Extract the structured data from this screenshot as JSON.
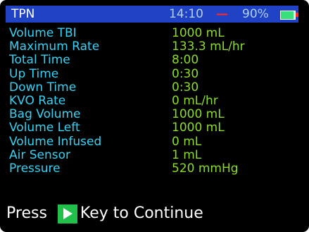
{
  "status": {
    "title": "TPN",
    "time": "14:10",
    "alarm_symbol": "—",
    "battery_text": "90%",
    "battery_level": 0.9
  },
  "rows": [
    {
      "label": "Volume TBI",
      "value": "1000 mL"
    },
    {
      "label": "Maximum Rate",
      "value": "133.3 mL/hr"
    },
    {
      "label": "Total Time",
      "value": "8:00"
    },
    {
      "label": "Up Time",
      "value": "0:30"
    },
    {
      "label": "Down Time",
      "value": "0:30"
    },
    {
      "label": "KVO Rate",
      "value": "0 mL/hr"
    },
    {
      "label": "Bag Volume",
      "value": "1000 mL"
    },
    {
      "label": "Volume Left",
      "value": "1000 mL"
    },
    {
      "label": "Volume Infused",
      "value": "0 mL"
    },
    {
      "label": "Air Sensor",
      "value": "1 mL"
    },
    {
      "label": "Pressure",
      "value": "520 mmHg"
    }
  ],
  "footer": {
    "press_text": "Press",
    "key_icon": "play-icon",
    "continue_text": "Key to Continue"
  },
  "colors": {
    "status_bar": "#1f43c4",
    "label_text": "#37d2f3",
    "value_text": "#8ddb27",
    "background": "#000000",
    "key_button": "#21c04b",
    "alarm": "#ff2a2a"
  }
}
